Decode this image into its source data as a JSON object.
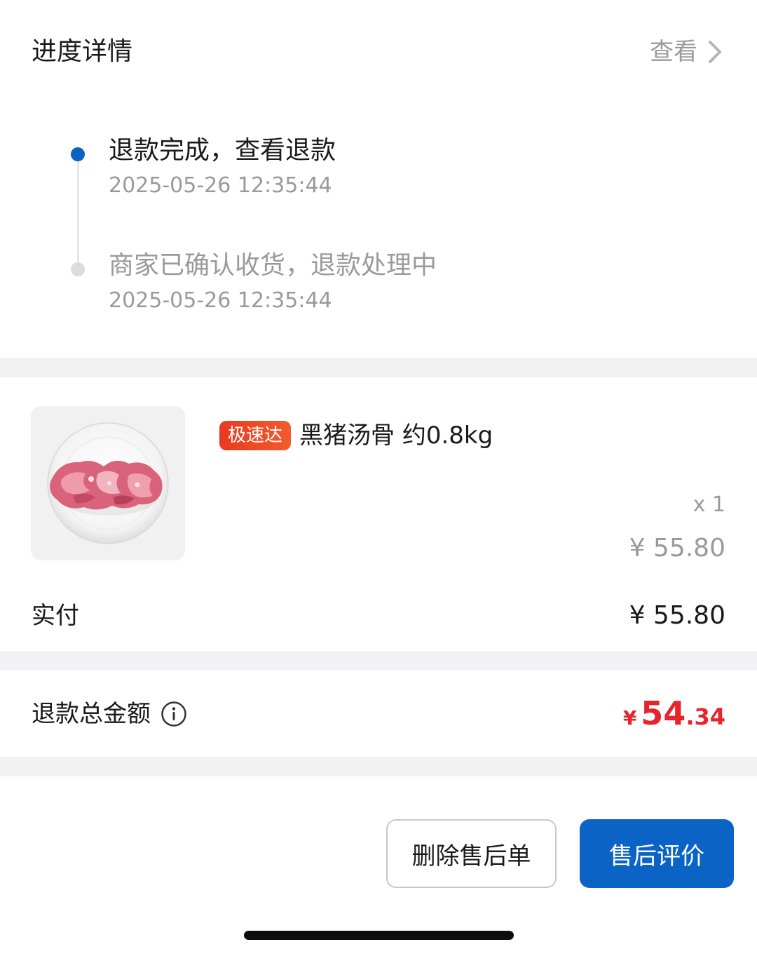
{
  "progress": {
    "title": "进度详情",
    "view_label": "查看",
    "steps": [
      {
        "text": "退款完成，查看退款",
        "time": "2025-05-26 12:35:44",
        "active": true
      },
      {
        "text": "商家已确认收货，退款处理中",
        "time": "2025-05-26 12:35:44",
        "active": false
      }
    ]
  },
  "product": {
    "tag": "极速达",
    "name": "黑猪汤骨 约0.8kg",
    "quantity": "x 1",
    "unit_price": "¥ 55.80",
    "paid_label": "实付",
    "paid_amount": "¥ 55.80"
  },
  "refund": {
    "label": "退款总金额",
    "currency": "¥",
    "amount_int": "54",
    "amount_dec": ".34"
  },
  "actions": {
    "delete_label": "删除售后单",
    "review_label": "售后评价"
  },
  "colors": {
    "accent_blue": "#0b63c5",
    "price_red": "#e5252b",
    "tag_orange": "#f04a25",
    "muted_text": "#9a9a9a",
    "gap_bg": "#f2f2f4"
  }
}
